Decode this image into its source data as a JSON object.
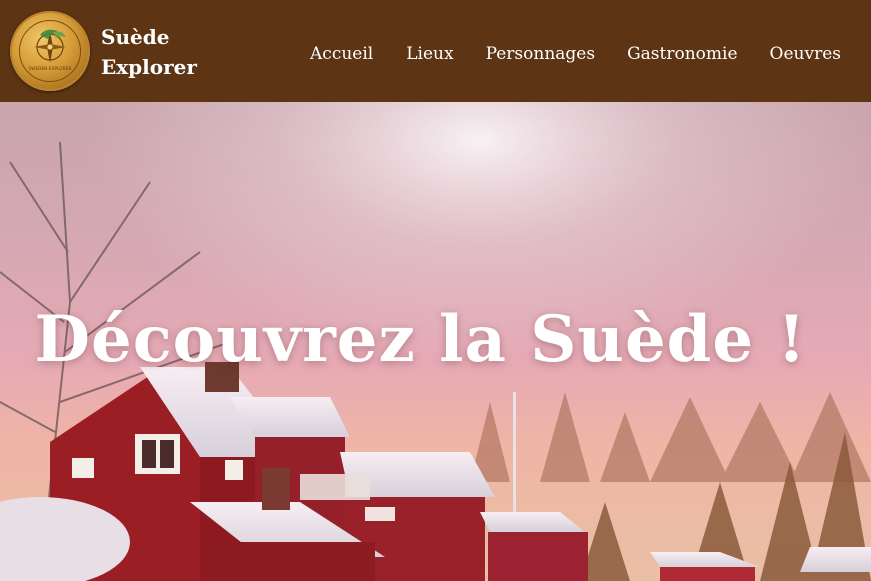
{
  "brand": {
    "line1": "Suède",
    "line2": "Explorer",
    "logo_text": "SWEDEN EXPLORER"
  },
  "nav": {
    "items": [
      {
        "label": "Accueil"
      },
      {
        "label": "Lieux"
      },
      {
        "label": "Personnages"
      },
      {
        "label": "Gastronomie"
      },
      {
        "label": "Oeuvres"
      }
    ]
  },
  "hero": {
    "title": "Découvrez la Suède !"
  },
  "colors": {
    "navbar": "#5e3514",
    "text": "#ffffff",
    "logo_gold": "#d49a35"
  }
}
